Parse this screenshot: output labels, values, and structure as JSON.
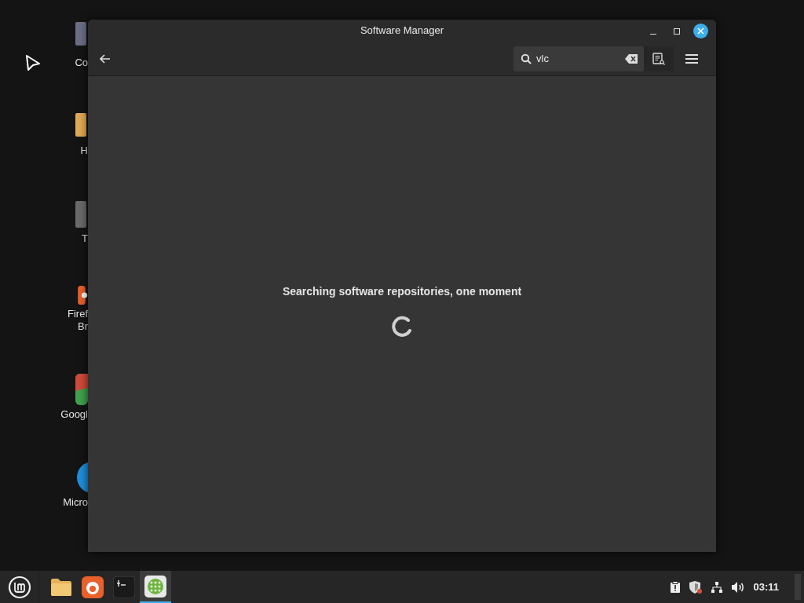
{
  "desktop": {
    "icons": [
      {
        "kind": "monitor",
        "lines": [
          "Co"
        ]
      },
      {
        "kind": "folder",
        "lines": [
          "H"
        ]
      },
      {
        "kind": "trash",
        "lines": [
          "T"
        ]
      },
      {
        "kind": "fox",
        "lines": [
          "Firef",
          "Br"
        ]
      },
      {
        "kind": "chrome",
        "lines": [
          "Googl"
        ]
      },
      {
        "kind": "edge",
        "lines": [
          "Micro"
        ]
      }
    ]
  },
  "window": {
    "title": "Software Manager",
    "search": {
      "value": "vlc"
    },
    "message": "Searching software repositories, one moment"
  },
  "taskbar": {
    "launchers": [
      {
        "kind": "folder",
        "active": false
      },
      {
        "kind": "fox",
        "active": false
      },
      {
        "kind": "terminal",
        "active": false
      },
      {
        "kind": "store",
        "active": true
      }
    ],
    "clock": "03:11"
  }
}
